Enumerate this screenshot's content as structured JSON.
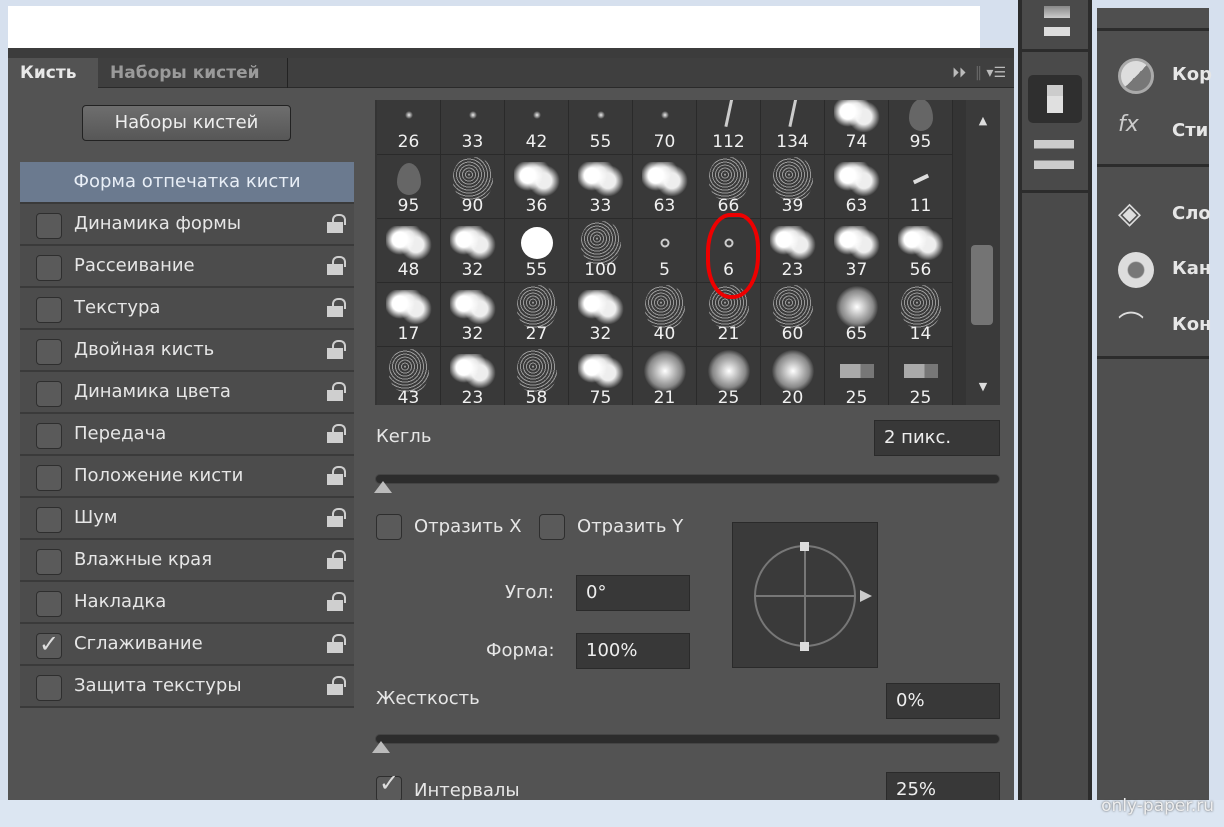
{
  "tabs": [
    {
      "label": "Кисть",
      "active": true
    },
    {
      "label": "Наборы кистей",
      "active": false
    }
  ],
  "preset_button": "Наборы кистей",
  "options": [
    {
      "label": "Форма отпечатка кисти",
      "selected": true
    },
    {
      "label": "Динамика формы",
      "checked": false
    },
    {
      "label": "Рассеивание",
      "checked": false
    },
    {
      "label": "Текстура",
      "checked": false
    },
    {
      "label": "Двойная кисть",
      "checked": false
    },
    {
      "label": "Динамика цвета",
      "checked": false
    },
    {
      "label": "Передача",
      "checked": false
    },
    {
      "label": "Положение кисти",
      "checked": false
    },
    {
      "label": "Шум",
      "checked": false
    },
    {
      "label": "Влажные края",
      "checked": false
    },
    {
      "label": "Накладка",
      "checked": false
    },
    {
      "label": "Сглаживание",
      "checked": true
    },
    {
      "label": "Защита текстуры",
      "checked": false
    }
  ],
  "brushes": [
    {
      "size": "26",
      "tip": "star"
    },
    {
      "size": "33",
      "tip": "star"
    },
    {
      "size": "42",
      "tip": "star"
    },
    {
      "size": "55",
      "tip": "star"
    },
    {
      "size": "70",
      "tip": "star"
    },
    {
      "size": "112",
      "tip": "stroke"
    },
    {
      "size": "134",
      "tip": "stroke"
    },
    {
      "size": "74",
      "tip": "splat"
    },
    {
      "size": "95",
      "tip": "leaf"
    },
    {
      "size": "95",
      "tip": "leaf"
    },
    {
      "size": "90",
      "tip": "noise"
    },
    {
      "size": "36",
      "tip": "splat"
    },
    {
      "size": "33",
      "tip": "splat"
    },
    {
      "size": "63",
      "tip": "splat"
    },
    {
      "size": "66",
      "tip": "noise"
    },
    {
      "size": "39",
      "tip": "noise"
    },
    {
      "size": "63",
      "tip": "splat"
    },
    {
      "size": "11",
      "tip": "dash"
    },
    {
      "size": "48",
      "tip": "splat"
    },
    {
      "size": "32",
      "tip": "splat"
    },
    {
      "size": "55",
      "tip": "hard"
    },
    {
      "size": "100",
      "tip": "noise"
    },
    {
      "size": "5",
      "tip": "dot"
    },
    {
      "size": "6",
      "tip": "dot"
    },
    {
      "size": "23",
      "tip": "splat"
    },
    {
      "size": "37",
      "tip": "splat"
    },
    {
      "size": "56",
      "tip": "splat"
    },
    {
      "size": "17",
      "tip": "splat"
    },
    {
      "size": "32",
      "tip": "splat"
    },
    {
      "size": "27",
      "tip": "noise"
    },
    {
      "size": "32",
      "tip": "splat"
    },
    {
      "size": "40",
      "tip": "noise"
    },
    {
      "size": "21",
      "tip": "noise"
    },
    {
      "size": "60",
      "tip": "noise"
    },
    {
      "size": "65",
      "tip": "soft"
    },
    {
      "size": "14",
      "tip": "noise"
    },
    {
      "size": "43",
      "tip": "noise"
    },
    {
      "size": "23",
      "tip": "splat"
    },
    {
      "size": "58",
      "tip": "noise"
    },
    {
      "size": "75",
      "tip": "splat"
    },
    {
      "size": "21",
      "tip": "soft"
    },
    {
      "size": "25",
      "tip": "soft"
    },
    {
      "size": "20",
      "tip": "soft"
    },
    {
      "size": "25",
      "tip": "pen"
    },
    {
      "size": "25",
      "tip": "pen"
    }
  ],
  "size": {
    "label": "Кегль",
    "value": "2 пикс.",
    "slider_fraction": 0.0
  },
  "flip_x": {
    "label": "Отразить X",
    "checked": false
  },
  "flip_y": {
    "label": "Отразить Y",
    "checked": false
  },
  "angle": {
    "label": "Угол:",
    "value": "0°"
  },
  "roundness": {
    "label": "Форма:",
    "value": "100%"
  },
  "hardness": {
    "label": "Жесткость",
    "value": "0%",
    "slider_fraction": 0.0
  },
  "spacing": {
    "label": "Интервалы",
    "value": "25%",
    "checked": true
  },
  "right_panel": {
    "items": [
      "Кор",
      "Сти",
      "Сло",
      "Кан",
      "Кон"
    ]
  },
  "watermark": "only-paper.ru",
  "colors": {
    "panel": "#535353",
    "selected": "#6b7a8f",
    "annotation": "#e00000"
  }
}
